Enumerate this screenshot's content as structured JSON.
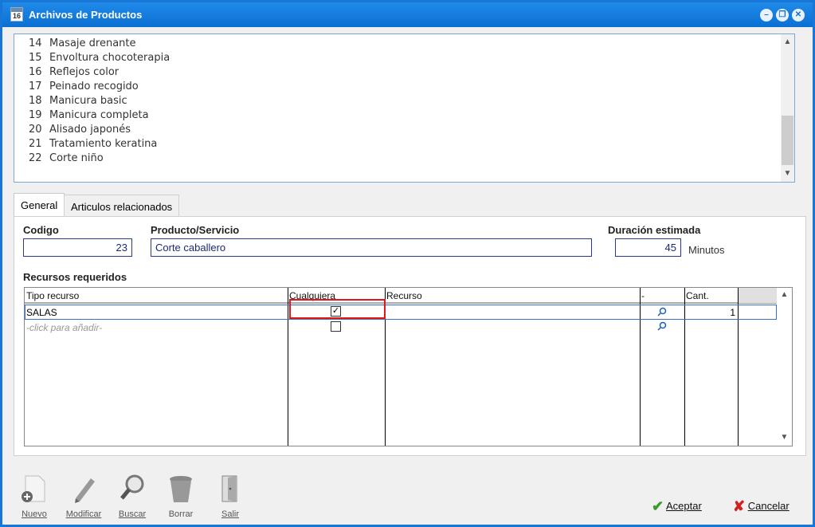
{
  "window": {
    "title": "Archivos de Productos",
    "icon_text": "16"
  },
  "products": [
    {
      "num": "14",
      "name": "Masaje drenante"
    },
    {
      "num": "15",
      "name": "Envoltura chocoterapia"
    },
    {
      "num": "16",
      "name": "Reflejos color"
    },
    {
      "num": "17",
      "name": "Peinado recogido"
    },
    {
      "num": "18",
      "name": "Manicura basic"
    },
    {
      "num": "19",
      "name": "Manicura completa"
    },
    {
      "num": "20",
      "name": "Alisado japonés"
    },
    {
      "num": "21",
      "name": "Tratamiento keratina"
    },
    {
      "num": "22",
      "name": "Corte niño"
    }
  ],
  "tabs": [
    {
      "label": "General"
    },
    {
      "label": "Articulos relacionados"
    }
  ],
  "form": {
    "codigo_label": "Codigo",
    "codigo_value": "23",
    "producto_label": "Producto/Servicio",
    "producto_value": "Corte caballero",
    "duracion_label": "Duración estimada",
    "duracion_value": "45",
    "duracion_unit": "Minutos",
    "recursos_label": "Recursos requeridos"
  },
  "grid": {
    "headers": {
      "tipo": "Tipo recurso",
      "cualquiera": "Cualquiera",
      "recurso": "Recurso",
      "dash": "-",
      "cant": "Cant."
    },
    "rows": [
      {
        "tipo": "SALAS",
        "cualquiera": true,
        "recurso": "",
        "cant": "1"
      }
    ],
    "add_placeholder": "-click para añadir-"
  },
  "toolbar": {
    "nuevo": "Nuevo",
    "modificar": "Modificar",
    "buscar": "Buscar",
    "borrar": "Borrar",
    "salir": "Salir",
    "aceptar": "Aceptar",
    "cancelar": "Cancelar"
  },
  "colors": {
    "titlebar": "#0c6fd3",
    "field_border": "#2a3a8a",
    "highlight": "#e01818"
  }
}
